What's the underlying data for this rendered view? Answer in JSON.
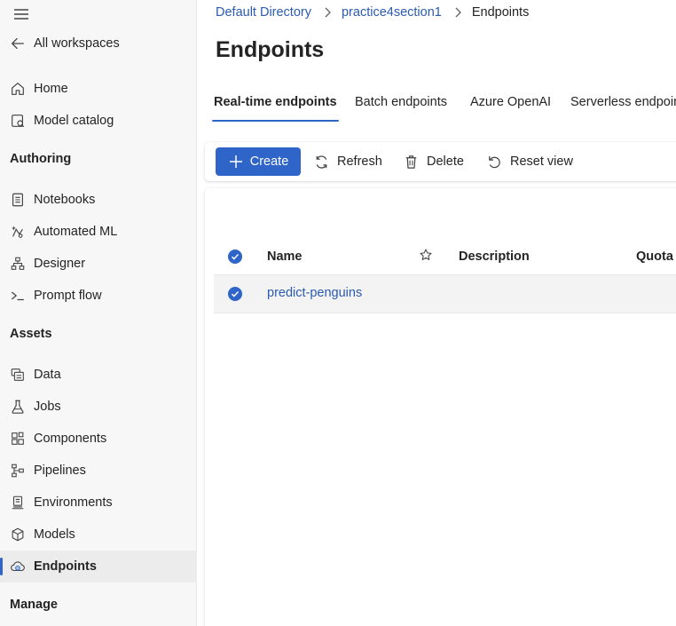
{
  "sidebar": {
    "back_label": "All workspaces",
    "items_top": [
      {
        "label": "Home",
        "icon": "home-icon"
      },
      {
        "label": "Model catalog",
        "icon": "model-catalog-icon"
      }
    ],
    "authoring": {
      "title": "Authoring",
      "items": [
        {
          "label": "Notebooks",
          "icon": "notebook-icon"
        },
        {
          "label": "Automated ML",
          "icon": "automated-ml-icon"
        },
        {
          "label": "Designer",
          "icon": "designer-icon"
        },
        {
          "label": "Prompt flow",
          "icon": "prompt-flow-icon"
        }
      ]
    },
    "assets": {
      "title": "Assets",
      "items": [
        {
          "label": "Data",
          "icon": "data-icon"
        },
        {
          "label": "Jobs",
          "icon": "jobs-icon"
        },
        {
          "label": "Components",
          "icon": "components-icon"
        },
        {
          "label": "Pipelines",
          "icon": "pipelines-icon"
        },
        {
          "label": "Environments",
          "icon": "environments-icon"
        },
        {
          "label": "Models",
          "icon": "models-icon"
        },
        {
          "label": "Endpoints",
          "icon": "endpoints-icon",
          "active": true
        }
      ]
    },
    "manage": {
      "title": "Manage"
    }
  },
  "breadcrumb": {
    "items": [
      "Default Directory",
      "practice4section1"
    ],
    "current": "Endpoints"
  },
  "page": {
    "title": "Endpoints"
  },
  "tabs": [
    {
      "label": "Real-time endpoints",
      "active": true
    },
    {
      "label": "Batch endpoints"
    },
    {
      "label": "Azure OpenAI"
    },
    {
      "label": "Serverless endpoints"
    }
  ],
  "toolbar": {
    "create_label": "Create",
    "refresh_label": "Refresh",
    "delete_label": "Delete",
    "reset_label": "Reset view"
  },
  "table": {
    "columns": [
      "Name",
      "Description",
      "Quota t"
    ],
    "rows": [
      {
        "name": "predict-penguins",
        "selected": true
      }
    ],
    "all_selected": true
  },
  "colors": {
    "accent": "#2f64c9",
    "link": "#2a5bb0",
    "sidebar_bg": "#f7f7f7"
  }
}
